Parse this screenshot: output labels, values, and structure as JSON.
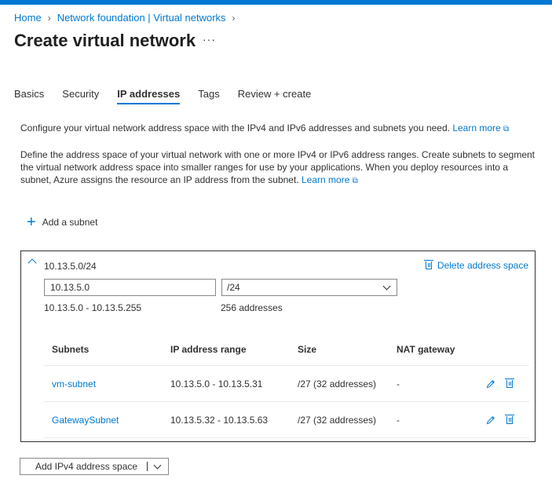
{
  "breadcrumb": {
    "items": [
      "Home",
      "Network foundation | Virtual networks"
    ]
  },
  "header": {
    "title": "Create virtual network",
    "more": "···"
  },
  "tabs": [
    {
      "label": "Basics"
    },
    {
      "label": "Security"
    },
    {
      "label": "IP addresses",
      "active": true
    },
    {
      "label": "Tags"
    },
    {
      "label": "Review + create"
    }
  ],
  "intro": {
    "text": "Configure your virtual network address space with the IPv4 and IPv6 addresses and subnets you need.",
    "link": "Learn more"
  },
  "description": {
    "text": "Define the address space of your virtual network with one or more IPv4 or IPv6 address ranges. Create subnets to segment the virtual network address space into smaller ranges for use by your applications. When you deploy resources into a subnet, Azure assigns the resource an IP address from the subnet.",
    "link": "Learn more"
  },
  "add_subnet": {
    "label": "Add a subnet"
  },
  "address_space": {
    "title": "10.13.5.0/24",
    "delete_label": "Delete address space",
    "address_value": "10.13.5.0",
    "cidr_value": "/24",
    "range": "10.13.5.0 - 10.13.5.255",
    "count": "256 addresses",
    "columns": [
      "Subnets",
      "IP address range",
      "Size",
      "NAT gateway"
    ],
    "subnets": [
      {
        "name": "vm-subnet",
        "range": "10.13.5.0 - 10.13.5.31",
        "size": "/27 (32 addresses)",
        "nat": "-"
      },
      {
        "name": "GatewaySubnet",
        "range": "10.13.5.32 - 10.13.5.63",
        "size": "/27 (32 addresses)",
        "nat": "-"
      }
    ]
  },
  "add_space_button": {
    "label": "Add IPv4 address space"
  },
  "colors": {
    "accent": "#0078d4",
    "text": "#323130",
    "border": "#8a8886"
  },
  "icons": {
    "add": "plus-icon",
    "delete": "trash-icon",
    "edit": "pencil-icon",
    "external": "external-link-icon",
    "collapse": "chevron-up-icon",
    "dropdown": "chevron-down-icon"
  }
}
